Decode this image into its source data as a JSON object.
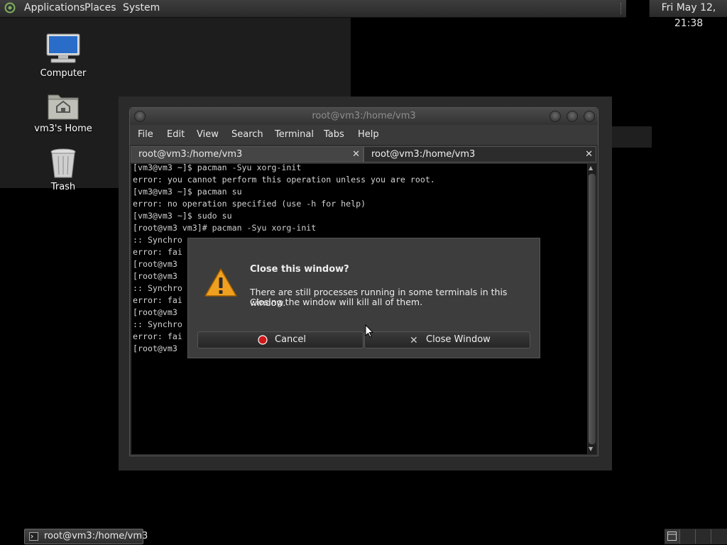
{
  "top_panel": {
    "menus": [
      "Applications",
      "Places",
      "System"
    ],
    "clock": "Fri May 12, 21:38"
  },
  "desktop": {
    "icons": [
      {
        "label": "Computer",
        "icon": "computer-icon"
      },
      {
        "label": "vm3's Home",
        "icon": "home-folder-icon"
      },
      {
        "label": "Trash",
        "icon": "trash-icon"
      }
    ]
  },
  "terminal": {
    "title": "root@vm3:/home/vm3",
    "menu": [
      "File",
      "Edit",
      "View",
      "Search",
      "Terminal",
      "Tabs",
      "Help"
    ],
    "tabs": [
      {
        "label": "root@vm3:/home/vm3",
        "active": false
      },
      {
        "label": "root@vm3:/home/vm3",
        "active": true
      }
    ],
    "lines": [
      "[vm3@vm3 ~]$ pacman -Syu xorg-init",
      "error: you cannot perform this operation unless you are root.",
      "[vm3@vm3 ~]$ pacman su",
      "error: no operation specified (use -h for help)",
      "[vm3@vm3 ~]$ sudo su",
      "[root@vm3 vm3]# pacman -Syu xorg-init",
      ":: Synchro",
      "error: fai",
      "[root@vm3",
      "[root@vm3",
      ":: Synchro",
      "error: fai",
      "[root@vm3",
      ":: Synchro",
      "error: fai",
      "[root@vm3"
    ]
  },
  "dialog": {
    "heading": "Close this window?",
    "message_line1": "There are still processes running in some terminals in this window.",
    "message_line2": "Closing the window will kill all of them.",
    "cancel_label": "Cancel",
    "close_label": "Close Window",
    "icon": "warning-icon"
  },
  "bottom_panel": {
    "task_label": "root@vm3:/home/vm3"
  },
  "colors": {
    "panel": "#2f2f2f",
    "terminal_bg": "#000000",
    "warning_orange": "#f0a020",
    "cancel_red": "#d01818"
  }
}
